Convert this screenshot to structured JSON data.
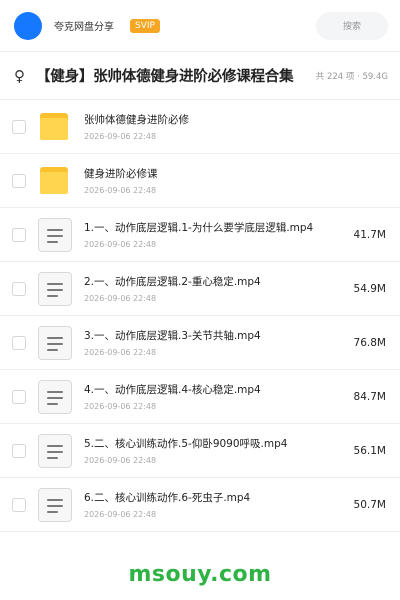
{
  "header": {
    "user_name": "夸克网盘分享",
    "badge": "SVIP",
    "search_label": "搜索"
  },
  "share": {
    "icon": "♀",
    "title": "【健身】张帅体德健身进阶必修课程合集",
    "summary": "共 224 项 · 59.4G"
  },
  "items": [
    {
      "type": "folder",
      "name": "张帅体德健身进阶必修",
      "date": "2026-09-06 22:48",
      "size": ""
    },
    {
      "type": "folder",
      "name": "健身进阶必修课",
      "date": "2026-09-06 22:48",
      "size": ""
    },
    {
      "type": "file",
      "name": "1.一、动作底层逻辑.1-为什么要学底层逻辑.mp4",
      "date": "2026-09-06 22:48",
      "size": "41.7M"
    },
    {
      "type": "file",
      "name": "2.一、动作底层逻辑.2-重心稳定.mp4",
      "date": "2026-09-06 22:48",
      "size": "54.9M"
    },
    {
      "type": "file",
      "name": "3.一、动作底层逻辑.3-关节共轴.mp4",
      "date": "2026-09-06 22:48",
      "size": "76.8M"
    },
    {
      "type": "file",
      "name": "4.一、动作底层逻辑.4-核心稳定.mp4",
      "date": "2026-09-06 22:48",
      "size": "84.7M"
    },
    {
      "type": "file",
      "name": "5.二、核心训练动作.5-仰卧9090呼吸.mp4",
      "date": "2026-09-06 22:48",
      "size": "56.1M"
    },
    {
      "type": "file",
      "name": "6.二、核心训练动作.6-死虫子.mp4",
      "date": "2026-09-06 22:48",
      "size": "50.7M"
    }
  ],
  "watermark": "msouy.com",
  "colors": {
    "avatar": "#1677ff",
    "badge": "#f5a623",
    "folder": "#ffd54f",
    "watermark": "#2fb344"
  }
}
